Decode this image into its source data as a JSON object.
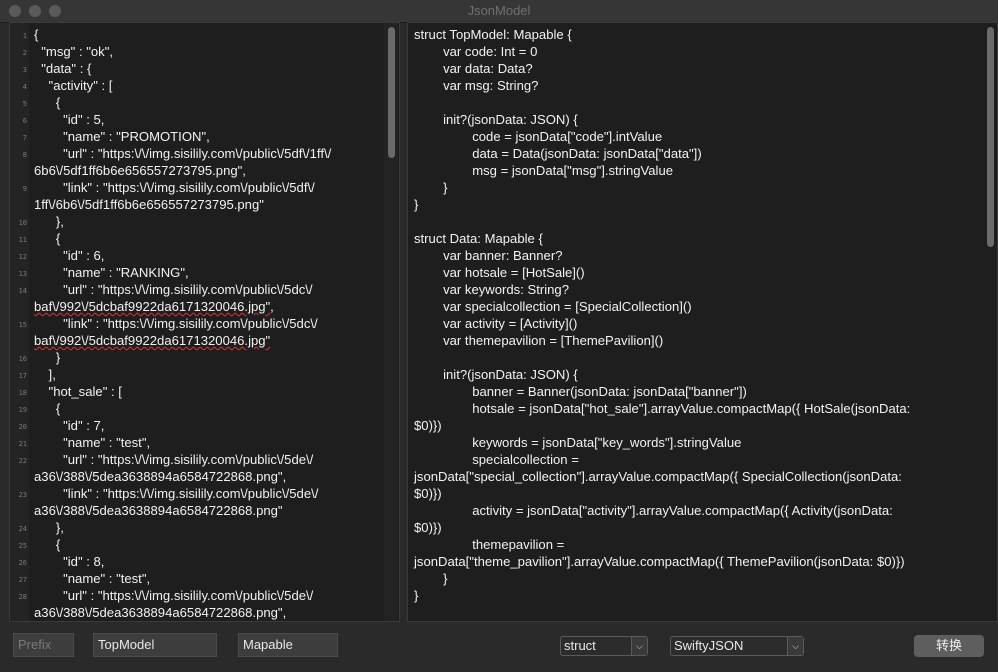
{
  "window": {
    "title": "JsonModel"
  },
  "left_code": [
    "{",
    "  \"msg\" : \"ok\",",
    "  \"data\" : {",
    "    \"activity\" : [",
    "      {",
    "        \"id\" : 5,",
    "        \"name\" : \"PROMOTION\",",
    "        \"url\" : \"https:\\/\\/img.sisilily.com\\/public\\/5df\\/1ff\\/",
    "6b6\\/5df1ff6b6e656557273795.png\",",
    "        \"link\" : \"https:\\/\\/img.sisilily.com\\/public\\/5df\\/",
    "1ff\\/6b6\\/5df1ff6b6e656557273795.png\"",
    "      },",
    "      {",
    "        \"id\" : 6,",
    "        \"name\" : \"RANKING\",",
    "        \"url\" : \"https:\\/\\/img.sisilily.com\\/public\\/5dc\\/",
    "baf\\/992\\/5dcbaf9922da6171320046.jpg\",",
    "        \"link\" : \"https:\\/\\/img.sisilily.com\\/public\\/5dc\\/",
    "baf\\/992\\/5dcbaf9922da6171320046.jpg\"",
    "      }",
    "    ],",
    "    \"hot_sale\" : [",
    "      {",
    "        \"id\" : 7,",
    "        \"name\" : \"test\",",
    "        \"url\" : \"https:\\/\\/img.sisilily.com\\/public\\/5de\\/",
    "a36\\/388\\/5dea3638894a6584722868.png\",",
    "        \"link\" : \"https:\\/\\/img.sisilily.com\\/public\\/5de\\/",
    "a36\\/388\\/5dea3638894a6584722868.png\"",
    "      },",
    "      {",
    "        \"id\" : 8,",
    "        \"name\" : \"test\",",
    "        \"url\" : \"https:\\/\\/img.sisilily.com\\/public\\/5de\\/",
    "a36\\/388\\/5dea3638894a6584722868.png\","
  ],
  "line_numbers": [
    {
      "n": "1",
      "row": 0
    },
    {
      "n": "2",
      "row": 1
    },
    {
      "n": "3",
      "row": 2
    },
    {
      "n": "4",
      "row": 3
    },
    {
      "n": "5",
      "row": 4
    },
    {
      "n": "6",
      "row": 5
    },
    {
      "n": "7",
      "row": 6
    },
    {
      "n": "8",
      "row": 7
    },
    {
      "n": "9",
      "row": 9
    },
    {
      "n": "10",
      "row": 11
    },
    {
      "n": "11",
      "row": 12
    },
    {
      "n": "12",
      "row": 13
    },
    {
      "n": "13",
      "row": 14
    },
    {
      "n": "14",
      "row": 15
    },
    {
      "n": "15",
      "row": 17
    },
    {
      "n": "16",
      "row": 19
    },
    {
      "n": "17",
      "row": 20
    },
    {
      "n": "18",
      "row": 21
    },
    {
      "n": "19",
      "row": 22
    },
    {
      "n": "20",
      "row": 23
    },
    {
      "n": "21",
      "row": 24
    },
    {
      "n": "22",
      "row": 25
    },
    {
      "n": "23",
      "row": 27
    },
    {
      "n": "24",
      "row": 29
    },
    {
      "n": "25",
      "row": 30
    },
    {
      "n": "26",
      "row": 31
    },
    {
      "n": "27",
      "row": 32
    },
    {
      "n": "28",
      "row": 33
    }
  ],
  "right_code": [
    "struct TopModel: Mapable {",
    "        var code: Int = 0",
    "        var data: Data?",
    "        var msg: String?",
    "",
    "        init?(jsonData: JSON) {",
    "                code = jsonData[\"code\"].intValue",
    "                data = Data(jsonData: jsonData[\"data\"])",
    "                msg = jsonData[\"msg\"].stringValue",
    "        }",
    "}",
    "",
    "struct Data: Mapable {",
    "        var banner: Banner?",
    "        var hotsale = [HotSale]()",
    "        var keywords: String?",
    "        var specialcollection = [SpecialCollection]()",
    "        var activity = [Activity]()",
    "        var themepavilion = [ThemePavilion]()",
    "",
    "        init?(jsonData: JSON) {",
    "                banner = Banner(jsonData: jsonData[\"banner\"])",
    "                hotsale = jsonData[\"hot_sale\"].arrayValue.compactMap({ HotSale(jsonData:",
    "$0)})",
    "                keywords = jsonData[\"key_words\"].stringValue",
    "                specialcollection =",
    "jsonData[\"special_collection\"].arrayValue.compactMap({ SpecialCollection(jsonData:",
    "$0)})",
    "                activity = jsonData[\"activity\"].arrayValue.compactMap({ Activity(jsonData:",
    "$0)})",
    "                themepavilion =",
    "jsonData[\"theme_pavilion\"].arrayValue.compactMap({ ThemePavilion(jsonData: $0)})",
    "        }",
    "}"
  ],
  "bottom": {
    "prefix_placeholder": "Prefix",
    "model_name": "TopModel",
    "protocol_name": "Mapable",
    "type_select": "struct",
    "lib_select": "SwiftyJSON",
    "convert_button": "转换"
  }
}
